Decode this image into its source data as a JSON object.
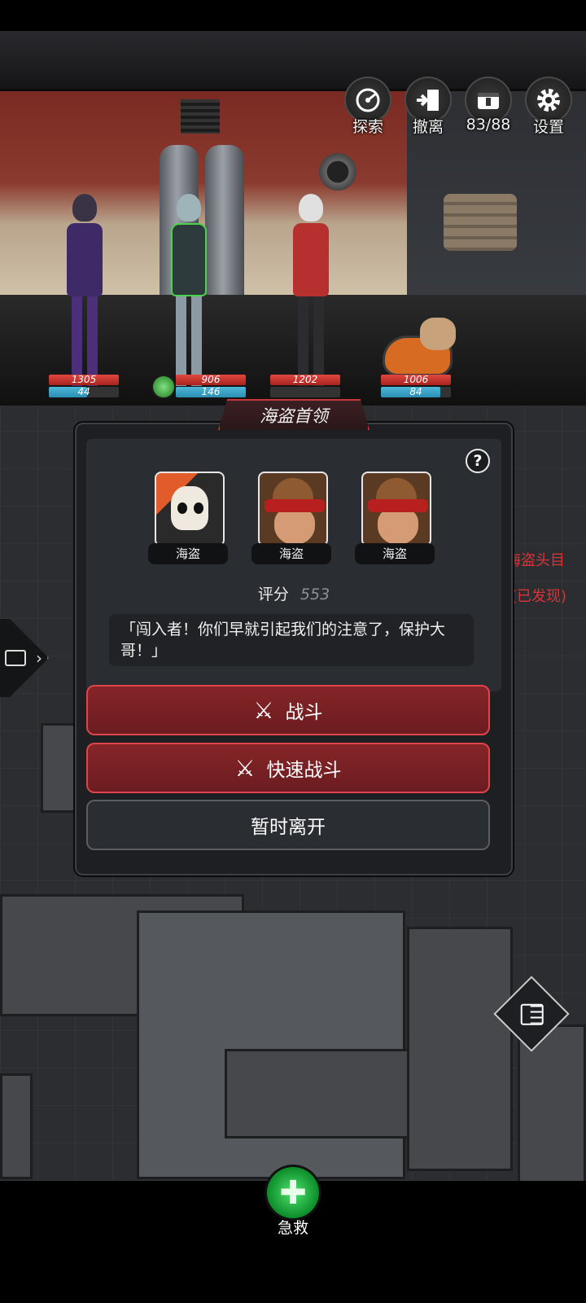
{
  "top_menu": {
    "explore": "探索",
    "retreat": "撤离",
    "supply": "83/88",
    "settings": "设置"
  },
  "party": [
    {
      "hp": "1305",
      "mp": "44",
      "mp_fill": 0.55
    },
    {
      "hp": "906",
      "mp": "146",
      "mp_fill": 1.0
    },
    {
      "hp": "1202",
      "mp": "",
      "mp_fill": 0.0
    },
    {
      "hp": "1006",
      "mp": "84",
      "mp_fill": 0.85
    }
  ],
  "dialog": {
    "title": "海盗首领",
    "help": "?",
    "enemies": [
      {
        "name": "海盗",
        "portrait": "skull-pirate"
      },
      {
        "name": "海盗",
        "portrait": "bandana-pirate"
      },
      {
        "name": "海盗",
        "portrait": "bandana-pirate"
      }
    ],
    "score_label": "评分",
    "score_value": "553",
    "quote": "「闯入者！你们早就引起我们的注意了，保护大哥！」",
    "fight_label": "战斗",
    "quick_fight_label": "快速战斗",
    "leave_label": "暂时离开"
  },
  "map_notes": {
    "pirate_boss": "海盗头目",
    "discovered": "(已发现)"
  },
  "bottom": {
    "first_aid_label": "急救"
  },
  "colors": {
    "accent_red": "#e04349",
    "hp_red": "#d33a33",
    "mp_blue": "#3aa3c8",
    "aid_green": "#1db33e"
  }
}
